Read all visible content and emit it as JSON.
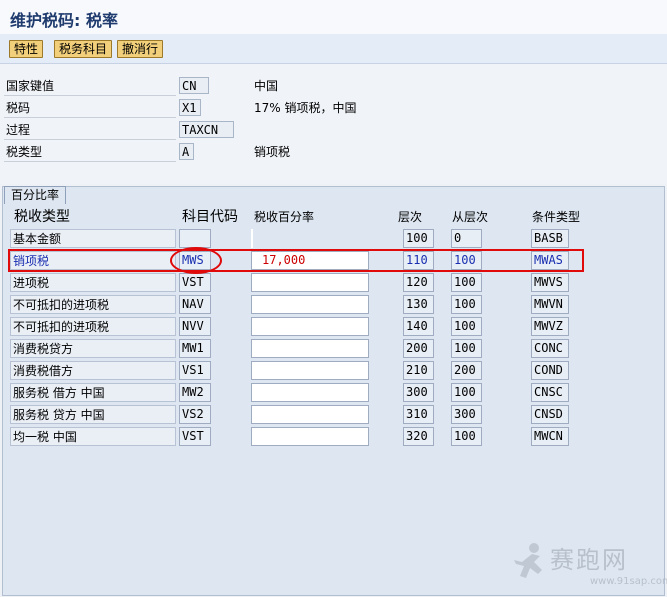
{
  "window": {
    "title": "维护税码: 税率"
  },
  "toolbar": {
    "buttons": [
      "特性",
      "税务科目",
      "撤消行"
    ]
  },
  "fields": [
    {
      "label": "国家键值",
      "value": "CN",
      "desc": "中国"
    },
    {
      "label": "税码",
      "value": "X1",
      "desc": "17% 销项税，中国"
    },
    {
      "label": "过程",
      "value": "TAXCN",
      "desc": ""
    },
    {
      "label": "税类型",
      "value": "A",
      "desc": "销项税"
    }
  ],
  "group": {
    "title": "百分比率",
    "columns": [
      "税收类型",
      "科目代码",
      "税收百分率",
      "层次",
      "从层次",
      "条件类型"
    ]
  },
  "rows": [
    {
      "type": "基本金额",
      "code": "",
      "rate": "",
      "level": "100",
      "from": "0",
      "cond": "BASB"
    },
    {
      "type": "销项税",
      "code": "MWS",
      "rate": "17,000",
      "level": "110",
      "from": "100",
      "cond": "MWAS"
    },
    {
      "type": "进项税",
      "code": "VST",
      "rate": "",
      "level": "120",
      "from": "100",
      "cond": "MWVS"
    },
    {
      "type": "不可抵扣的进项税",
      "code": "NAV",
      "rate": "",
      "level": "130",
      "from": "100",
      "cond": "MWVN"
    },
    {
      "type": "不可抵扣的进项税",
      "code": "NVV",
      "rate": "",
      "level": "140",
      "from": "100",
      "cond": "MWVZ"
    },
    {
      "type": "消费税贷方",
      "code": "MW1",
      "rate": "",
      "level": "200",
      "from": "100",
      "cond": "CONC"
    },
    {
      "type": "消费税借方",
      "code": "VS1",
      "rate": "",
      "level": "210",
      "from": "200",
      "cond": "COND"
    },
    {
      "type": "服务税 借方 中国",
      "code": "MW2",
      "rate": "",
      "level": "300",
      "from": "100",
      "cond": "CNSC"
    },
    {
      "type": "服务税 贷方 中国",
      "code": "VS2",
      "rate": "",
      "level": "310",
      "from": "300",
      "cond": "CNSD"
    },
    {
      "type": "均一税 中国",
      "code": "VST",
      "rate": "",
      "level": "320",
      "from": "100",
      "cond": "MWCN"
    }
  ],
  "watermark": {
    "text": "赛跑网",
    "url": "www.91sap.com"
  },
  "colors": {
    "highlight": "#e00a0a",
    "selected_text": "#1a2fb0",
    "rate_text": "#cc0000"
  }
}
